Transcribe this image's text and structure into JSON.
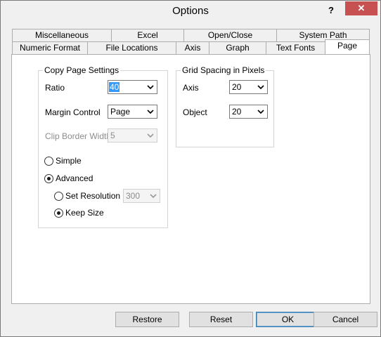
{
  "window": {
    "title": "Options",
    "help_label": "?",
    "close_label": "✕"
  },
  "tabs_row1": [
    {
      "label": "Miscellaneous"
    },
    {
      "label": "Excel"
    },
    {
      "label": "Open/Close"
    },
    {
      "label": "System Path"
    }
  ],
  "tabs_row2": [
    {
      "label": "Numeric Format"
    },
    {
      "label": "File Locations"
    },
    {
      "label": "Axis"
    },
    {
      "label": "Graph"
    },
    {
      "label": "Text Fonts"
    },
    {
      "label": "Page",
      "active": true
    }
  ],
  "copy_page": {
    "title": "Copy Page Settings",
    "ratio_label": "Ratio",
    "ratio_value": "40",
    "margin_label": "Margin Control",
    "margin_value": "Page",
    "clip_label": "Clip Border Width",
    "clip_value": "5",
    "simple_label": "Simple",
    "advanced_label": "Advanced",
    "set_resolution_label": "Set Resolution",
    "resolution_value": "300",
    "keep_size_label": "Keep Size",
    "mode_selected": "Advanced",
    "advanced_option_selected": "Keep Size"
  },
  "grid_spacing": {
    "title": "Grid Spacing in Pixels",
    "axis_label": "Axis",
    "axis_value": "20",
    "object_label": "Object",
    "object_value": "20"
  },
  "buttons": {
    "restore": "Restore",
    "reset": "Reset",
    "ok": "OK",
    "cancel": "Cancel"
  },
  "icons": [
    "help-icon",
    "close-icon",
    "dropdown-arrow-icon",
    "radio-icon"
  ]
}
